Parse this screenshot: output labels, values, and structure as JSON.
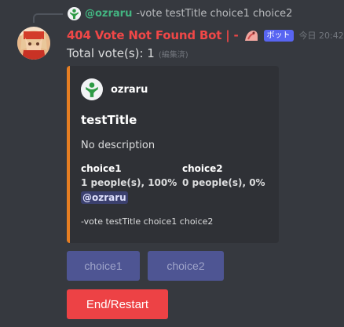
{
  "reply": {
    "username": "@ozraru",
    "text": "-vote testTitle choice1 choice2"
  },
  "message": {
    "username": "404 Vote Not Found Bot | -",
    "bot_tag": "ボット",
    "timestamp": "今日 20:42",
    "content": "Total vote(s): 1",
    "edited": "(編集済)"
  },
  "embed": {
    "accent_color": "#e67e22",
    "author": "ozraru",
    "title": "testTitle",
    "description": "No description",
    "fields": [
      {
        "name": "choice1",
        "value": "1 people(s), 100%",
        "mention": "@ozraru"
      },
      {
        "name": "choice2",
        "value": "0 people(s), 0%"
      }
    ],
    "footer": "-vote testTitle choice1 choice2"
  },
  "buttons": {
    "choice1": "choice1",
    "choice2": "choice2",
    "end_restart": "End/Restart"
  },
  "colors": {
    "background": "#36393f",
    "embed_background": "#2f3136",
    "username_red": "#f04747",
    "mention_green": "#43b581",
    "bot_tag": "#5865f2",
    "danger": "#ed4245"
  }
}
